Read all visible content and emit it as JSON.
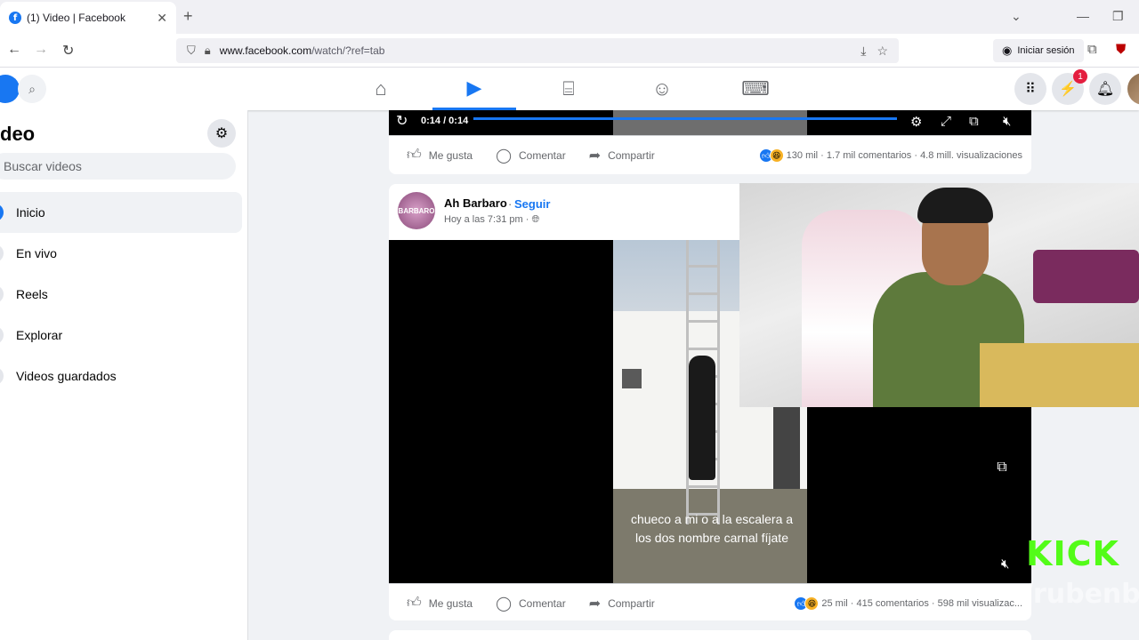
{
  "browser": {
    "tab_title": "(1) Video | Facebook",
    "tab_favicon": "f",
    "close_tab": "✕",
    "new_tab": "+",
    "url_domain": "www.facebook.com",
    "url_path": "/watch/?ref=tab",
    "signin_label": "Iniciar sesión"
  },
  "fb": {
    "accent": "#1877f2",
    "nav_tabs": [
      "home-icon",
      "video-icon",
      "marketplace-icon",
      "groups-icon",
      "gaming-icon"
    ],
    "messenger_badge": "1"
  },
  "sidebar": {
    "title": "deo",
    "search_placeholder": "Buscar videos",
    "items": [
      {
        "label": "Inicio",
        "active": true
      },
      {
        "label": "En vivo"
      },
      {
        "label": "Reels"
      },
      {
        "label": "Explorar"
      },
      {
        "label": "Videos guardados"
      }
    ]
  },
  "post1": {
    "video_time": "0:14 / 0:14",
    "actions": {
      "like": "Me gusta",
      "comment": "Comentar",
      "share": "Compartir"
    },
    "stats": {
      "reactions": "130 mil",
      "comments": "1.7 mil comentarios",
      "views": "4.8 mill. visualizaciones"
    }
  },
  "post2": {
    "author": "Ah Barbaro",
    "follow": "Seguir",
    "separator": "·",
    "time": "Hoy a las 7:31 pm · ",
    "avatar_text": "BARBARO",
    "caption_line1": "chueco a mi o a la escalera a",
    "caption_line2": "los dos nombre carnal fíjate",
    "actions": {
      "like": "Me gusta",
      "comment": "Comentar",
      "share": "Compartir"
    },
    "stats": {
      "reactions": "25 mil",
      "comments": "415 comentarios",
      "views": "598 mil visualizac..."
    }
  },
  "overlay": {
    "kick_logo": "KICK",
    "kick_user": "/rubenb"
  }
}
